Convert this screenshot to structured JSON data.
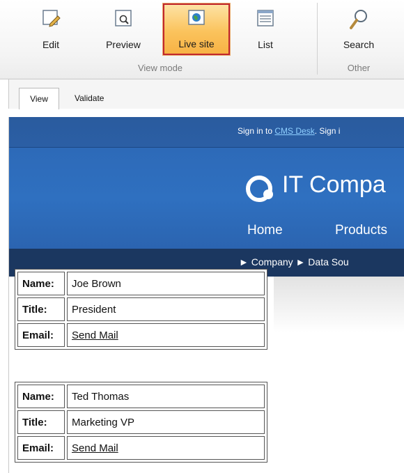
{
  "ribbon": {
    "buttons": [
      {
        "label": "Edit",
        "icon": "edit-icon"
      },
      {
        "label": "Preview",
        "icon": "preview-icon"
      },
      {
        "label": "Live site",
        "icon": "globe-icon",
        "active": true
      },
      {
        "label": "List",
        "icon": "list-icon"
      },
      {
        "label": "Search",
        "icon": "search-icon"
      }
    ],
    "groups": {
      "view_mode": "View mode",
      "other": "Other"
    }
  },
  "tabs": [
    "View",
    "Validate"
  ],
  "site": {
    "signin_prefix": "Sign in to ",
    "signin_link": "CMS Desk",
    "signin_suffix": ". Sign i",
    "logo_text": "IT Compa",
    "nav": [
      "Home",
      "Products"
    ],
    "breadcrumb": "► Company ► Data Sou"
  },
  "records": [
    {
      "name_label": "Name:",
      "name": "Joe Brown",
      "title_label": "Title:",
      "title": "President",
      "email_label": "Email:",
      "email": "Send Mail"
    },
    {
      "name_label": "Name:",
      "name": "Ted Thomas",
      "title_label": "Title:",
      "title": "Marketing VP",
      "email_label": "Email:",
      "email": "Send Mail"
    }
  ],
  "colors": {
    "active_highlight": "#fbc35c",
    "active_border": "#c0262e",
    "header_blue": "#2f70c0",
    "breadcrumb_bar": "#1b3760"
  }
}
